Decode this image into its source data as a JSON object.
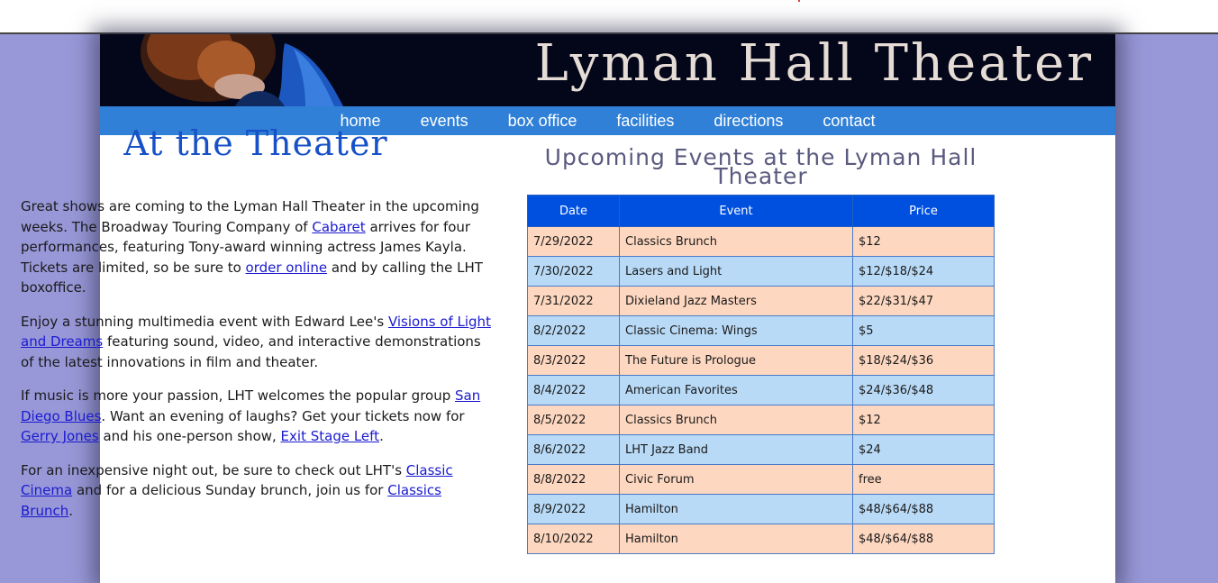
{
  "site": {
    "title": "Lyman Hall Theater"
  },
  "nav": [
    {
      "label": "home"
    },
    {
      "label": "events"
    },
    {
      "label": "box office"
    },
    {
      "label": "facilities"
    },
    {
      "label": "directions"
    },
    {
      "label": "contact"
    }
  ],
  "main": {
    "heading": "At the Theater",
    "p1": {
      "t1": "Great shows are coming to the Lyman Hall Theater in the upcoming weeks. The Broadway Touring Company of ",
      "link1": "Cabaret",
      "t2": " arrives for four performances, featuring Tony-award winning actress James Kayla. Tickets are limited, so be sure to ",
      "link2": "order online",
      "t3": " and by calling the LHT boxoffice."
    },
    "p2": {
      "t1": "Enjoy a stunning multimedia event with Edward Lee's ",
      "link1": "Visions of Light and Dreams",
      "t2": " featuring sound, video, and interactive demonstrations of the latest innovations in film and theater."
    },
    "p3": {
      "t1": "If music is more your passion, LHT welcomes the popular group ",
      "link1": "San Diego Blues",
      "t2": ". Want an evening of laughs? Get your tickets now for ",
      "link2": "Gerry Jones",
      "t3": " and his one-person show, ",
      "link3": "Exit Stage Left",
      "t4": "."
    },
    "p4": {
      "t1": "For an inexpensive night out, be sure to check out LHT's ",
      "link1": "Classic Cinema",
      "t2": " and for a delicious Sunday brunch, join us for ",
      "link2": "Classics Brunch",
      "t3": "."
    }
  },
  "events": {
    "heading": "Upcoming Events at the Lyman Hall Theater",
    "headers": {
      "date": "Date",
      "event": "Event",
      "price": "Price"
    },
    "rows": [
      {
        "date": "7/29/2022",
        "event": "Classics Brunch",
        "price": "$12"
      },
      {
        "date": "7/30/2022",
        "event": "Lasers and Light",
        "price": "$12/$18/$24"
      },
      {
        "date": "7/31/2022",
        "event": "Dixieland Jazz Masters",
        "price": "$22/$31/$47"
      },
      {
        "date": "8/2/2022",
        "event": "Classic Cinema: Wings",
        "price": "$5"
      },
      {
        "date": "8/3/2022",
        "event": "The Future is Prologue",
        "price": "$18/$24/$36"
      },
      {
        "date": "8/4/2022",
        "event": "American Favorites",
        "price": "$24/$36/$48"
      },
      {
        "date": "8/5/2022",
        "event": "Classics Brunch",
        "price": "$12"
      },
      {
        "date": "8/6/2022",
        "event": "LHT Jazz Band",
        "price": "$24"
      },
      {
        "date": "8/8/2022",
        "event": "Civic Forum",
        "price": "free"
      },
      {
        "date": "8/9/2022",
        "event": "Hamilton",
        "price": "$48/$64/$88"
      },
      {
        "date": "8/10/2022",
        "event": "Hamilton",
        "price": "$48/$64/$88"
      }
    ]
  },
  "colors": {
    "page_background": "#9898d8",
    "banner": "#04071a",
    "nav_bar": "#3080d8",
    "heading_blue": "#1751c7",
    "table_header": "#0050e0",
    "row_peach": "#fdd7c0",
    "row_blue": "#b8daf6",
    "link": "#1a1ad0"
  }
}
